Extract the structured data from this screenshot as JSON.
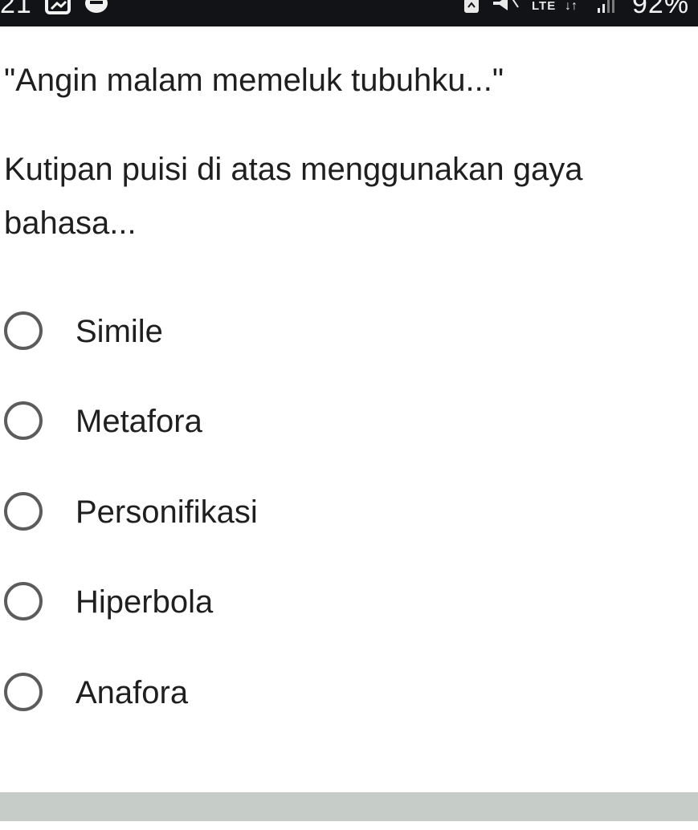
{
  "status_bar": {
    "time": "21",
    "network": "LTE",
    "data_arrows": "↓↑",
    "battery": "92%"
  },
  "question": {
    "quote": "\"Angin malam memeluk tubuhku...\"",
    "prompt": "Kutipan puisi di atas menggunakan gaya bahasa..."
  },
  "options": [
    {
      "label": "Simile",
      "selected": false
    },
    {
      "label": "Metafora",
      "selected": false
    },
    {
      "label": "Personifikasi",
      "selected": false
    },
    {
      "label": "Hiperbola",
      "selected": false
    },
    {
      "label": "Anafora",
      "selected": false
    }
  ]
}
